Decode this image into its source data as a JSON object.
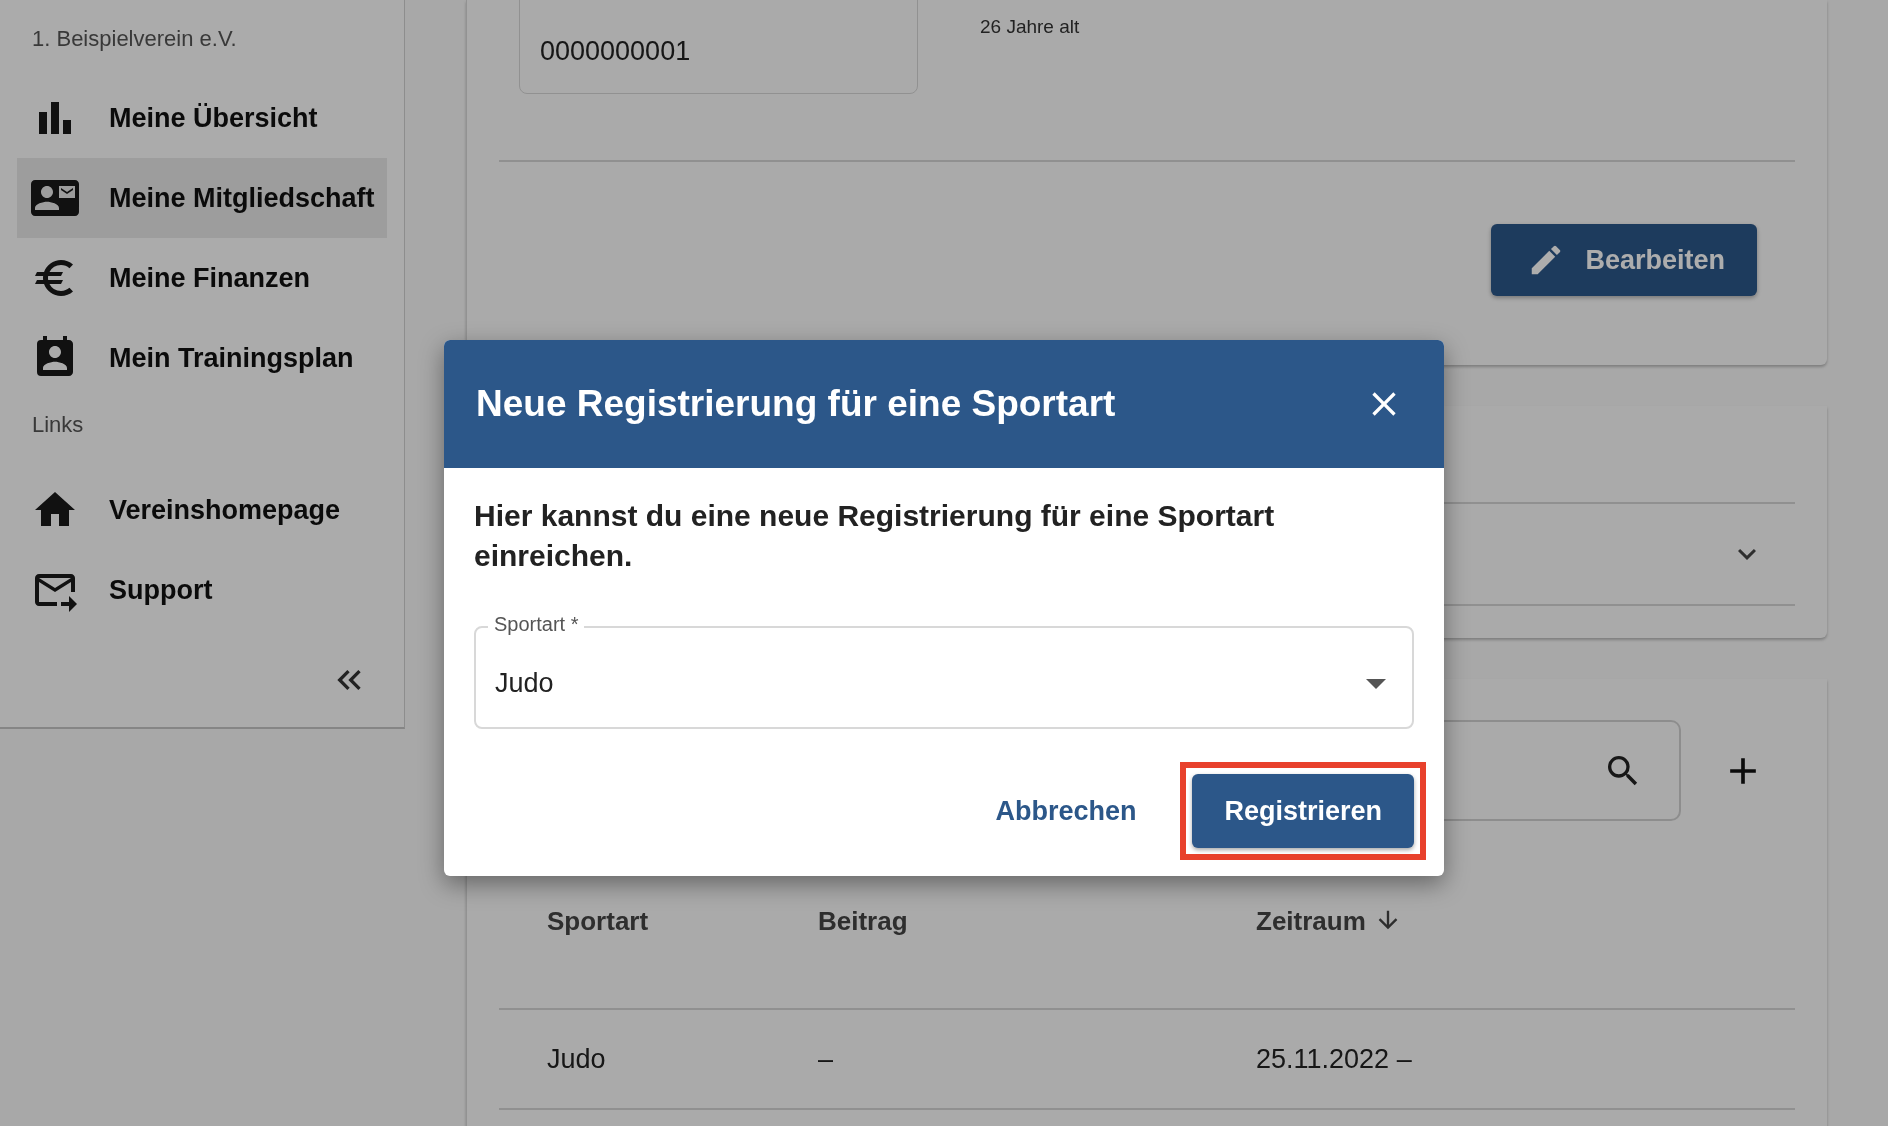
{
  "sidebar": {
    "org": "1. Beispielverein e.V.",
    "items": [
      {
        "label": "Meine Übersicht",
        "selected": false
      },
      {
        "label": "Meine Mitgliedschaft",
        "selected": true
      },
      {
        "label": "Meine Finanzen",
        "selected": false
      },
      {
        "label": "Mein Trainingsplan",
        "selected": false
      }
    ],
    "section": "Links",
    "links": [
      {
        "label": "Vereinshomepage"
      },
      {
        "label": "Support"
      }
    ]
  },
  "profile": {
    "member_number": "0000000001",
    "age": "26 Jahre alt",
    "edit_button": "Bearbeiten"
  },
  "registrations": {
    "columns": [
      {
        "label": "Sportart",
        "sorted": false
      },
      {
        "label": "Beitrag",
        "sorted": false
      },
      {
        "label": "Zeitraum",
        "sorted": true
      }
    ],
    "rows": [
      [
        "Judo",
        "–",
        "25.11.2022 –"
      ]
    ]
  },
  "dialog": {
    "title": "Neue Registrierung für eine Sportart",
    "text": "Hier kannst du eine neue Registrierung für eine Sportart einreichen.",
    "field": {
      "label": "Sportart *",
      "value": "Judo"
    },
    "buttons": [
      {
        "label": "Abbrechen",
        "kind": "text",
        "highlighted": false
      },
      {
        "label": "Registrieren",
        "kind": "primary",
        "highlighted": true
      }
    ]
  }
}
